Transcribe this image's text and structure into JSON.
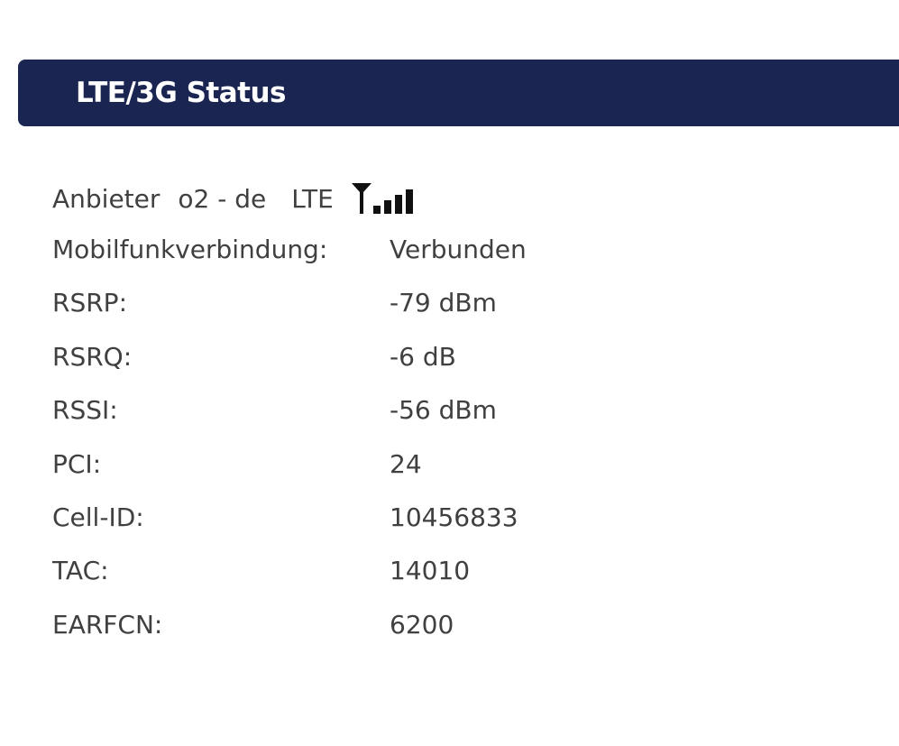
{
  "header": {
    "title": "LTE/3G Status"
  },
  "provider": {
    "label": "Anbieter",
    "name": "o2 - de",
    "network_type": "LTE",
    "signal_icon": "antenna-signal-bars-icon",
    "signal_bars_active": 4,
    "signal_bars_total": 4
  },
  "status_rows": [
    {
      "label": "Mobilfunkverbindung:",
      "value": "Verbunden"
    },
    {
      "label": "RSRP:",
      "value": "-79 dBm"
    },
    {
      "label": "RSRQ:",
      "value": "-6 dB"
    },
    {
      "label": "RSSI:",
      "value": "-56 dBm"
    },
    {
      "label": "PCI:",
      "value": "24"
    },
    {
      "label": "Cell-ID:",
      "value": "10456833"
    },
    {
      "label": "TAC:",
      "value": "14010"
    },
    {
      "label": "EARFCN:",
      "value": "6200"
    }
  ],
  "colors": {
    "header_background": "#1b2551",
    "header_text": "#ffffff",
    "body_text": "#404040",
    "page_background": "#ffffff"
  }
}
